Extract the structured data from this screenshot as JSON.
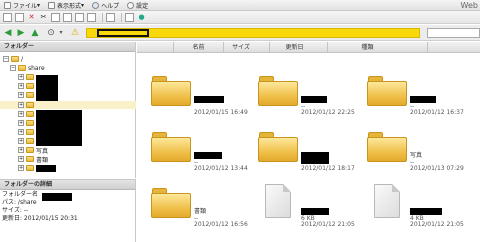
{
  "menu": {
    "file": "ファイル",
    "view": "表示形式",
    "help": "ヘルプ",
    "settings": "設定",
    "app_title": "Web"
  },
  "tree": {
    "header": "フォルダー",
    "root": "/",
    "share": "share",
    "photos": "写真",
    "documents": "書類"
  },
  "details": {
    "header": "フォルダーの詳細",
    "name_label": "フォルダー名",
    "path": "パス: /share",
    "size": "サイズ: --",
    "updated": "更新日: 2012/01/15 20:31"
  },
  "columns": {
    "name": "名前",
    "size": "サイズ",
    "updated": "更新日",
    "kind": "種類"
  },
  "items": [
    {
      "kind": "folder",
      "name": "",
      "sub": "",
      "date": "2012/01/15 16:49"
    },
    {
      "kind": "folder",
      "name": "",
      "sub": "--",
      "date": "2012/01/12 22:25"
    },
    {
      "kind": "folder",
      "name": "",
      "sub": "--",
      "date": "2012/01/12 16:37"
    },
    {
      "kind": "folder",
      "name": "",
      "sub": "--",
      "date": "2012/01/12 13:44"
    },
    {
      "kind": "folder",
      "name": "",
      "sub": "",
      "date": "2012/01/12 18:17"
    },
    {
      "kind": "folder",
      "name": "写真",
      "sub": "--",
      "date": "2012/01/13 07:29"
    },
    {
      "kind": "folder",
      "name": "書類",
      "sub": "--",
      "date": "2012/01/12 16:56"
    },
    {
      "kind": "file",
      "name": "",
      "sub": "6 KB",
      "date": "2012/01/12 21:05"
    },
    {
      "kind": "file",
      "name": "",
      "sub": "4 KB",
      "date": "2012/01/12 21:05"
    }
  ],
  "colors": {
    "path_bar": "#f9d80b",
    "selected_row": "#fbf1c8",
    "folder": "#f0c14c"
  }
}
